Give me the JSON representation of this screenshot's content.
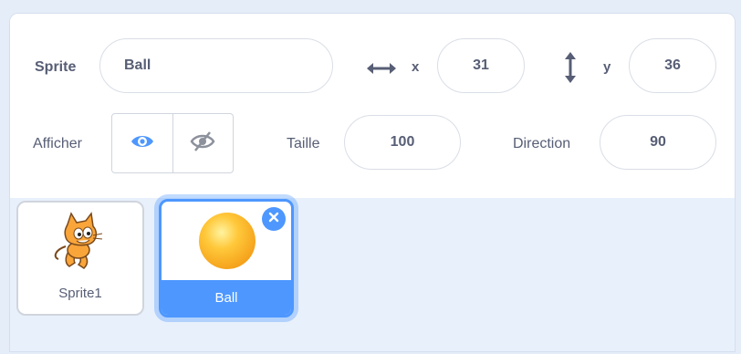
{
  "sprite_info": {
    "sprite_label": "Sprite",
    "sprite_name": "Ball",
    "x_label": "x",
    "x_value": "31",
    "y_label": "y",
    "y_value": "36",
    "show_label": "Afficher",
    "size_label": "Taille",
    "size_value": "100",
    "direction_label": "Direction",
    "direction_value": "90"
  },
  "sprites": [
    {
      "name": "Sprite1",
      "selected": false,
      "icon": "cat-costume"
    },
    {
      "name": "Ball",
      "selected": true,
      "icon": "ball-costume"
    }
  ],
  "colors": {
    "accent": "#4d97ff",
    "text": "#575e75",
    "background": "#e5edf9"
  }
}
